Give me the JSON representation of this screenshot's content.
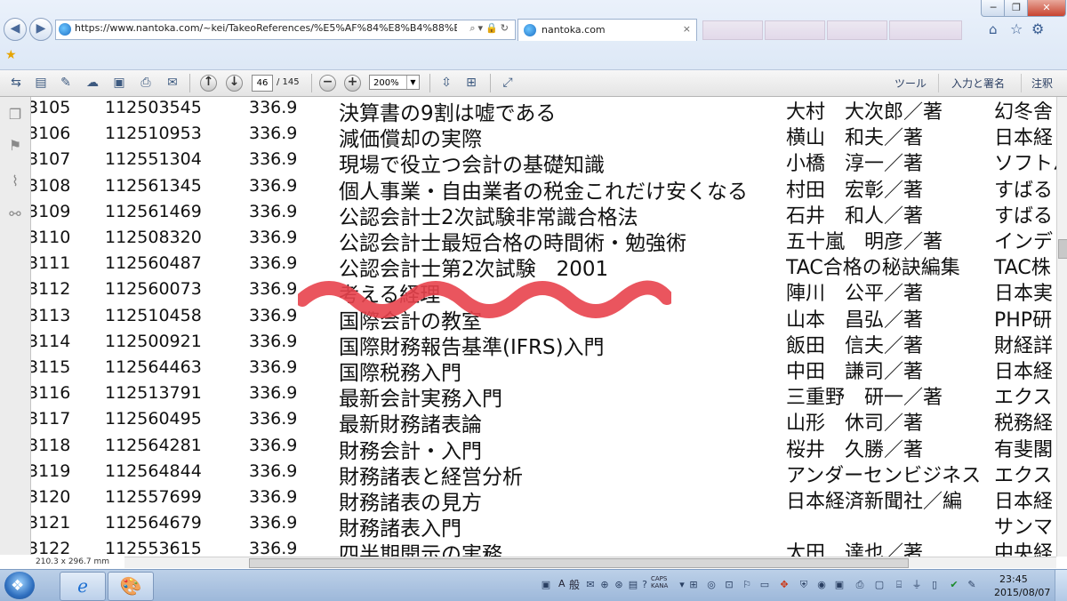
{
  "browser": {
    "address": "https://www.nantoka.com/~kei/TakeoReferences/%E5%AF%84%E8%B4%88%E8%",
    "tab_title": "nantoka.com",
    "tab_close": "×"
  },
  "pdf_toolbar": {
    "page_current": "46",
    "page_total": "/ 145",
    "zoom": "200%",
    "tools_label": "ツール",
    "sign_label": "入力と署名",
    "comment_label": "注釈"
  },
  "document": {
    "page_size": "210.3 x 296.7 mm",
    "rows": [
      {
        "no": "3105",
        "code": "112503545",
        "class": "336.9",
        "title": "決算書の9割は嘘である",
        "author": "大村　大次郎／著",
        "publisher": "幻冬舎"
      },
      {
        "no": "3106",
        "code": "112510953",
        "class": "336.9",
        "title": "減価償却の実際",
        "author": "横山　和夫／著",
        "publisher": "日本経"
      },
      {
        "no": "3107",
        "code": "112551304",
        "class": "336.9",
        "title": "現場で役立つ会計の基礎知識",
        "author": "小橋　淳一／著",
        "publisher": "ソフトバ"
      },
      {
        "no": "3108",
        "code": "112561345",
        "class": "336.9",
        "title": "個人事業・自由業者の税金これだけ安くなる",
        "author": "村田　宏彰／著",
        "publisher": "すばる"
      },
      {
        "no": "3109",
        "code": "112561469",
        "class": "336.9",
        "title": "公認会計士2次試験非常識合格法",
        "author": "石井　和人／著",
        "publisher": "すばる"
      },
      {
        "no": "3110",
        "code": "112508320",
        "class": "336.9",
        "title": "公認会計士最短合格の時間術・勉強術",
        "author": "五十嵐　明彦／著",
        "publisher": "インデ"
      },
      {
        "no": "3111",
        "code": "112560487",
        "class": "336.9",
        "title": "公認会計士第2次試験　2001",
        "author": "TAC合格の秘訣編集",
        "publisher": "TAC株"
      },
      {
        "no": "3112",
        "code": "112560073",
        "class": "336.9",
        "title": "考える経理",
        "author": "陣川　公平／著",
        "publisher": "日本実"
      },
      {
        "no": "3113",
        "code": "112510458",
        "class": "336.9",
        "title": "国際会計の教室",
        "author": "山本　昌弘／著",
        "publisher": "PHP研"
      },
      {
        "no": "3114",
        "code": "112500921",
        "class": "336.9",
        "title": "国際財務報告基準(IFRS)入門",
        "author": "飯田　信夫／著",
        "publisher": "財経詳"
      },
      {
        "no": "3115",
        "code": "112564463",
        "class": "336.9",
        "title": "国際税務入門",
        "author": "中田　謙司／著",
        "publisher": "日本経"
      },
      {
        "no": "3116",
        "code": "112513791",
        "class": "336.9",
        "title": "最新会計実務入門",
        "author": "三重野　研一／著",
        "publisher": "エクス"
      },
      {
        "no": "3117",
        "code": "112560495",
        "class": "336.9",
        "title": "最新財務諸表論",
        "author": "山形　休司／著",
        "publisher": "税務経"
      },
      {
        "no": "3118",
        "code": "112564281",
        "class": "336.9",
        "title": "財務会計・入門",
        "author": "桜井　久勝／著",
        "publisher": "有斐閣"
      },
      {
        "no": "3119",
        "code": "112564844",
        "class": "336.9",
        "title": "財務諸表と経営分析",
        "author": "アンダーセンビジネス",
        "publisher": "エクス"
      },
      {
        "no": "3120",
        "code": "112557699",
        "class": "336.9",
        "title": "財務諸表の見方",
        "author": "日本経済新聞社／編",
        "publisher": "日本経"
      },
      {
        "no": "3121",
        "code": "112564679",
        "class": "336.9",
        "title": "財務諸表入門",
        "author": "",
        "publisher": "サンマ"
      },
      {
        "no": "3122",
        "code": "112553615",
        "class": "336.9",
        "title": "四半期開示の実務",
        "author": "太田　達也／著",
        "publisher": "中央経"
      }
    ]
  },
  "taskbar": {
    "lang_a": "A",
    "lang_kan": "般",
    "caps": "CAPS\nKANA",
    "time": "23:45",
    "date": "2015/08/07"
  },
  "colors": {
    "highlight_mark": "#e8434d",
    "toolbar_text": "#2b3f63"
  }
}
